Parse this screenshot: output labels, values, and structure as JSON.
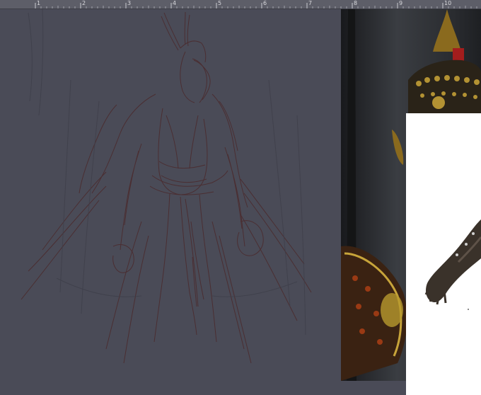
{
  "ruler": {
    "numbers": [
      "1",
      "2",
      "3",
      "4",
      "5",
      "6",
      "7",
      "8",
      "9",
      "10"
    ]
  },
  "canvas": {
    "background_color": "#4a4b57",
    "sketch_stroke_color": "#4a2a2c"
  },
  "reference_images": [
    {
      "name": "armor-photo",
      "background_color": "#1f2124"
    },
    {
      "name": "gauntlet-cutout",
      "background_color": "#ffffff"
    }
  ]
}
